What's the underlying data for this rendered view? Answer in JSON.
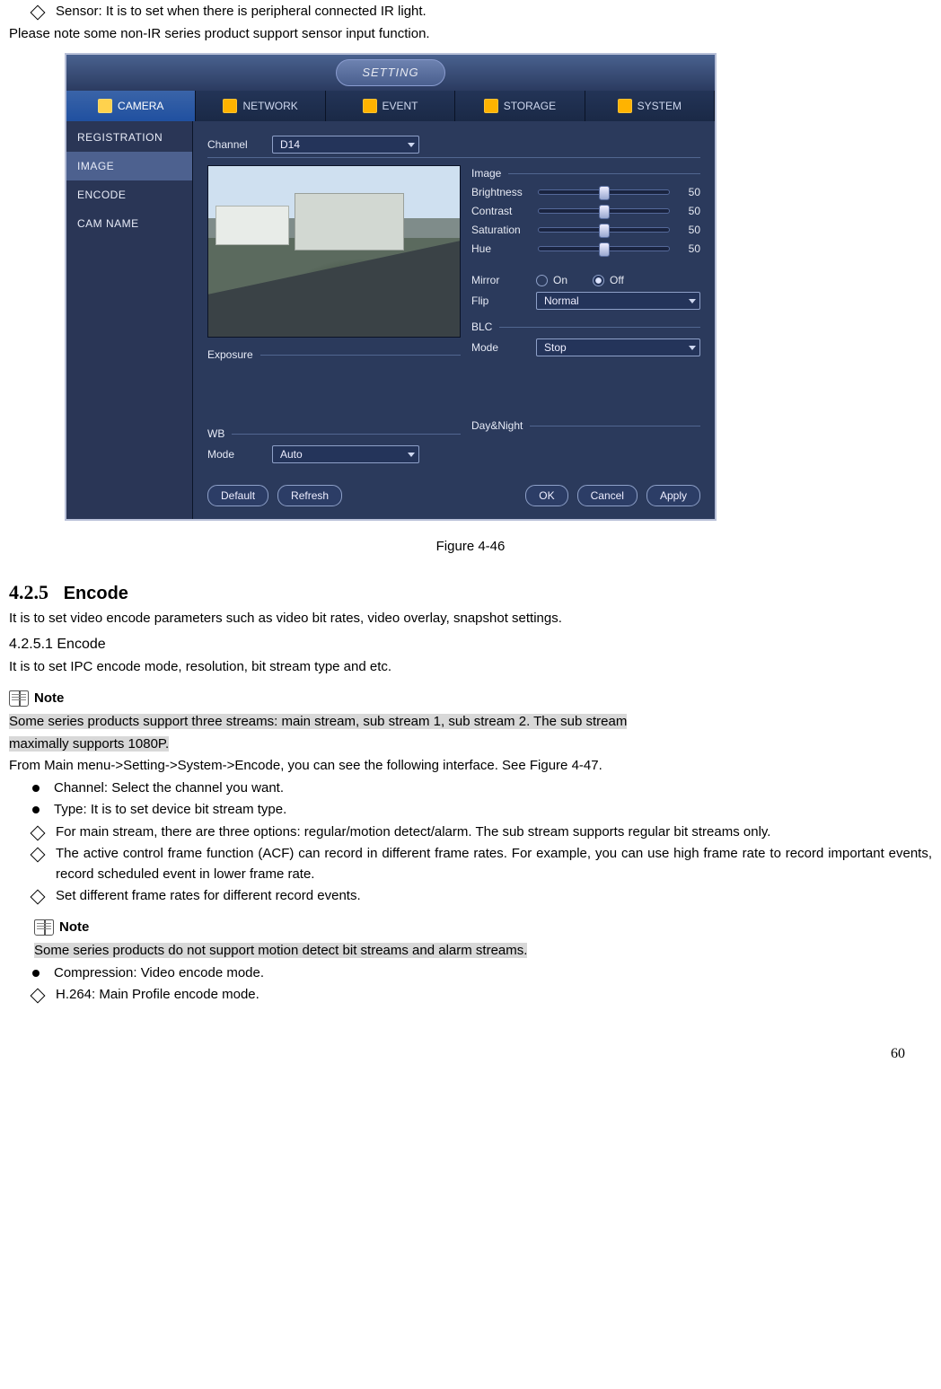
{
  "intro": {
    "sensor_line": "Sensor: It is to set when there is peripheral connected IR light.",
    "please_note": "Please note some non-IR series product support sensor input function."
  },
  "ui": {
    "title": "SETTING",
    "tabs": {
      "camera": {
        "label": "CAMERA",
        "icon": "camera-icon"
      },
      "network": {
        "label": "NETWORK",
        "icon": "network-icon"
      },
      "event": {
        "label": "EVENT",
        "icon": "event-icon"
      },
      "storage": {
        "label": "STORAGE",
        "icon": "storage-icon"
      },
      "system": {
        "label": "SYSTEM",
        "icon": "system-icon"
      }
    },
    "side": [
      "REGISTRATION",
      "IMAGE",
      "ENCODE",
      "CAM NAME"
    ],
    "side_selected": 1,
    "channel_label": "Channel",
    "channel_value": "D14",
    "exposure_label": "Exposure",
    "wb_label": "WB",
    "mode_label": "Mode",
    "wb_mode_value": "Auto",
    "image_label": "Image",
    "sliders": [
      {
        "label": "Brightness",
        "value": "50"
      },
      {
        "label": "Contrast",
        "value": "50"
      },
      {
        "label": "Saturation",
        "value": "50"
      },
      {
        "label": "Hue",
        "value": "50"
      }
    ],
    "mirror_label": "Mirror",
    "on": "On",
    "off": "Off",
    "flip_label": "Flip",
    "flip_value": "Normal",
    "blc_label": "BLC",
    "blc_mode_value": "Stop",
    "daynight_label": "Day&Night",
    "buttons": {
      "default": "Default",
      "refresh": "Refresh",
      "ok": "OK",
      "cancel": "Cancel",
      "apply": "Apply"
    }
  },
  "fig_caption": "Figure 4-46",
  "sec425": {
    "num": "4.2.5",
    "title": "Encode"
  },
  "p425_intro": "It is to set video encode parameters such as video bit rates, video overlay, snapshot settings.",
  "sec4251": "4.2.5.1  Encode",
  "p4251_intro": "It is to set IPC encode mode, resolution, bit stream type and etc.",
  "note_label": "Note",
  "note1a": "Some series products support three streams: main stream, sub stream 1, sub stream 2. The sub stream ",
  "note1b": "maximally supports 1080P.",
  "from_main": "From Main menu->Setting->System->Encode, you can see the following interface. See Figure 4-47.",
  "li_channel": "Channel: Select the channel you want.",
  "li_type": "Type: It is to set device bit stream type.",
  "li_main_stream": "For main stream, there are three options: regular/motion detect/alarm. The sub stream supports regular bit streams only.",
  "li_acf": "The active control frame function (ACF) can record in different frame rates. For example, you can use high frame rate to record important events, record scheduled event in lower frame rate.",
  "li_set_rates": "Set different frame rates for different record events.",
  "note2": "Some series products do not support motion detect bit streams and alarm streams.  ",
  "li_compression": "Compression: Video encode mode.",
  "li_h264": "H.264: Main Profile encode mode.",
  "page_number": "60"
}
